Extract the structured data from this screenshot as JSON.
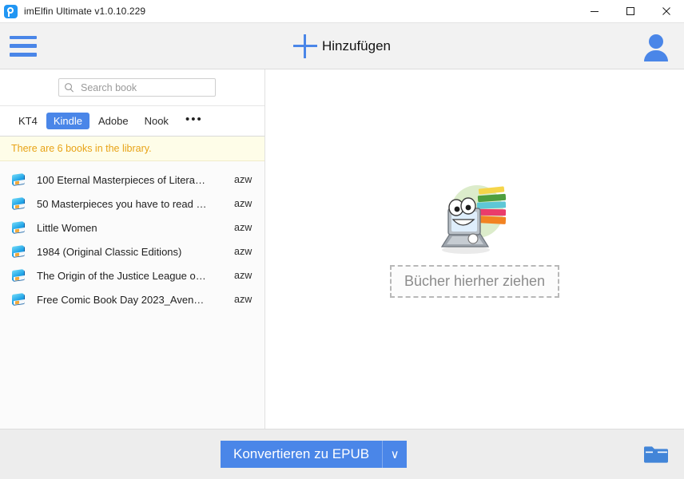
{
  "window": {
    "title": "imElfin Ultimate v1.0.10.229",
    "app_icon": "app-logo-icon",
    "minimize_label": "minimize-icon",
    "maximize_label": "maximize-icon",
    "close_label": "close-icon"
  },
  "toolbar": {
    "menu_icon": "hamburger-menu-icon",
    "add_label": "Hinzufügen",
    "add_icon": "plus-icon",
    "account_icon": "user-avatar-icon"
  },
  "sidebar": {
    "search": {
      "placeholder": "Search book",
      "value": "",
      "icon": "search-icon"
    },
    "tabs": [
      {
        "label": "KT4",
        "active": false
      },
      {
        "label": "Kindle",
        "active": true
      },
      {
        "label": "Adobe",
        "active": false
      },
      {
        "label": "Nook",
        "active": false
      }
    ],
    "more_tabs_label": "•••",
    "notice": "There are 6 books in the library.",
    "book_count": 6,
    "books": [
      {
        "title": "100 Eternal Masterpieces of Litera…",
        "format": "azw"
      },
      {
        "title": "50 Masterpieces you have to read …",
        "format": "azw"
      },
      {
        "title": "Little Women",
        "format": "azw"
      },
      {
        "title": "1984 (Original Classic Editions)",
        "format": "azw"
      },
      {
        "title": "The Origin of the Justice League o…",
        "format": "azw"
      },
      {
        "title": "Free Comic Book Day 2023_Aven…",
        "format": "azw"
      }
    ]
  },
  "drop_area": {
    "text": "Bücher hierher ziehen",
    "illustration": "laptop-with-books-mascot"
  },
  "bottom_bar": {
    "convert_label": "Konvertieren zu EPUB",
    "dropdown_caret": "∨",
    "folder_icon": "output-folder-icon"
  },
  "colors": {
    "accent": "#4a86e8",
    "notice_text": "#e8a317",
    "notice_background": "#fefde8",
    "toolbar_background": "#f2f2f2",
    "bottom_background": "#ededed"
  }
}
